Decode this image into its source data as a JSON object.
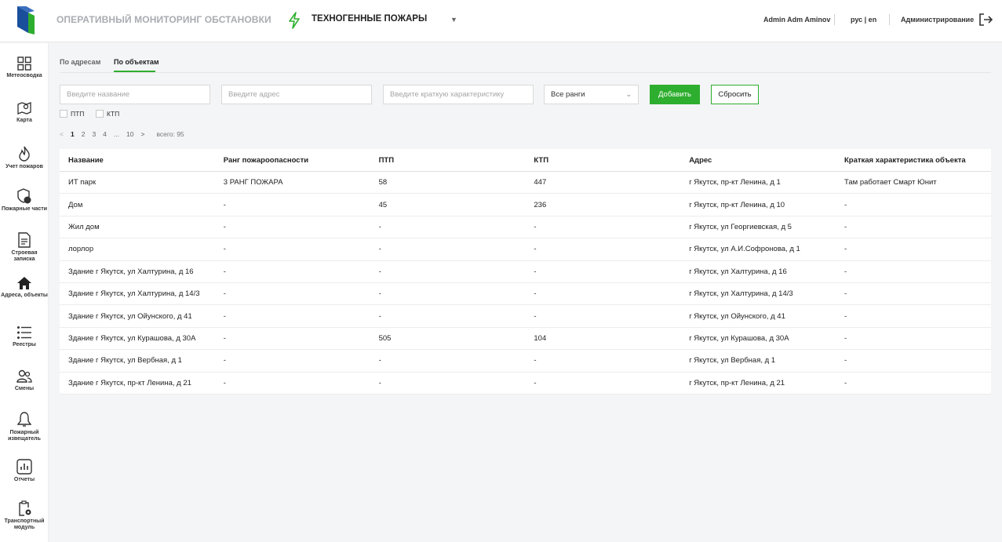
{
  "header": {
    "app_title": "ОПЕРАТИВНЫЙ МОНИТОРИНГ ОБСТАНОВКИ",
    "module_title": "ТЕХНОГЕННЫЕ ПОЖАРЫ",
    "user_name": "Admin Adm Aminov",
    "lang": "рус | en",
    "admin_link": "Администрирование",
    "accent_color": "#2eae2e",
    "logo_color": "#1a4f9c"
  },
  "sidebar": {
    "items": [
      {
        "label": "Метеосводка",
        "icon": "grid-icon"
      },
      {
        "label": "Карта",
        "icon": "map-icon"
      },
      {
        "label": "Учет пожаров",
        "icon": "fire-icon"
      },
      {
        "label": "Пожарные части",
        "icon": "fire-station-icon"
      },
      {
        "label": "Строевая записка",
        "icon": "document-icon"
      },
      {
        "label": "Адреса, объекты",
        "icon": "home-icon"
      },
      {
        "label": "Реестры",
        "icon": "list-icon"
      },
      {
        "label": "Смены",
        "icon": "users-icon"
      },
      {
        "label": "Пожарный извещатель",
        "icon": "bell-icon"
      },
      {
        "label": "Отчеты",
        "icon": "chart-icon"
      },
      {
        "label": "Транспортный модуль",
        "icon": "clipboard-gear-icon"
      }
    ]
  },
  "tabs": [
    {
      "label": "По адресам"
    },
    {
      "label": "По объектам"
    }
  ],
  "filters": {
    "name_placeholder": "Введите название",
    "address_placeholder": "Введите адрес",
    "description_placeholder": "Введите краткую характеристику",
    "rank_select": "Все ранги",
    "add_button": "Добавить",
    "reset_button": "Сбросить",
    "checkbox_ptp": "ПТП",
    "checkbox_ktp": "КТП"
  },
  "pagination": {
    "pages": [
      "1",
      "2",
      "3",
      "4",
      "...",
      "10"
    ],
    "total": "всего: 95"
  },
  "table": {
    "columns": [
      "Название",
      "Ранг пожароопасности",
      "ПТП",
      "КТП",
      "Адрес",
      "Краткая характеристика объекта"
    ],
    "rows": [
      [
        "ИТ парк",
        "3 РАНГ ПОЖАРА",
        "58",
        "447",
        "г Якутск, пр-кт Ленина, д 1",
        "Там работает Смарт Юнит"
      ],
      [
        "Дом",
        "-",
        "45",
        "236",
        "г Якутск, пр-кт Ленина, д 10",
        "-"
      ],
      [
        "Жил дом",
        "-",
        "-",
        "-",
        "г Якутск, ул Георгиевская, д 5",
        "-"
      ],
      [
        "лорлор",
        "-",
        "-",
        "-",
        "г Якутск, ул А.И.Софронова, д 1",
        "-"
      ],
      [
        "Здание г Якутск, ул Халтурина, д 16",
        "-",
        "-",
        "-",
        "г Якутск, ул Халтурина, д 16",
        "-"
      ],
      [
        "Здание г Якутск, ул Халтурина, д 14/3",
        "-",
        "-",
        "-",
        "г Якутск, ул Халтурина, д 14/3",
        "-"
      ],
      [
        "Здание г Якутск, ул Ойунского, д 41",
        "-",
        "-",
        "-",
        "г Якутск, ул Ойунского, д 41",
        "-"
      ],
      [
        "Здание г Якутск, ул Курашова, д 30А",
        "-",
        "505",
        "104",
        "г Якутск, ул Курашова, д 30А",
        "-"
      ],
      [
        "Здание г Якутск, ул Вербная, д 1",
        "-",
        "-",
        "-",
        "г Якутск, ул Вербная, д 1",
        "-"
      ],
      [
        "Здание г Якутск, пр-кт Ленина, д 21",
        "-",
        "-",
        "-",
        "г Якутск, пр-кт Ленина, д 21",
        "-"
      ]
    ]
  }
}
